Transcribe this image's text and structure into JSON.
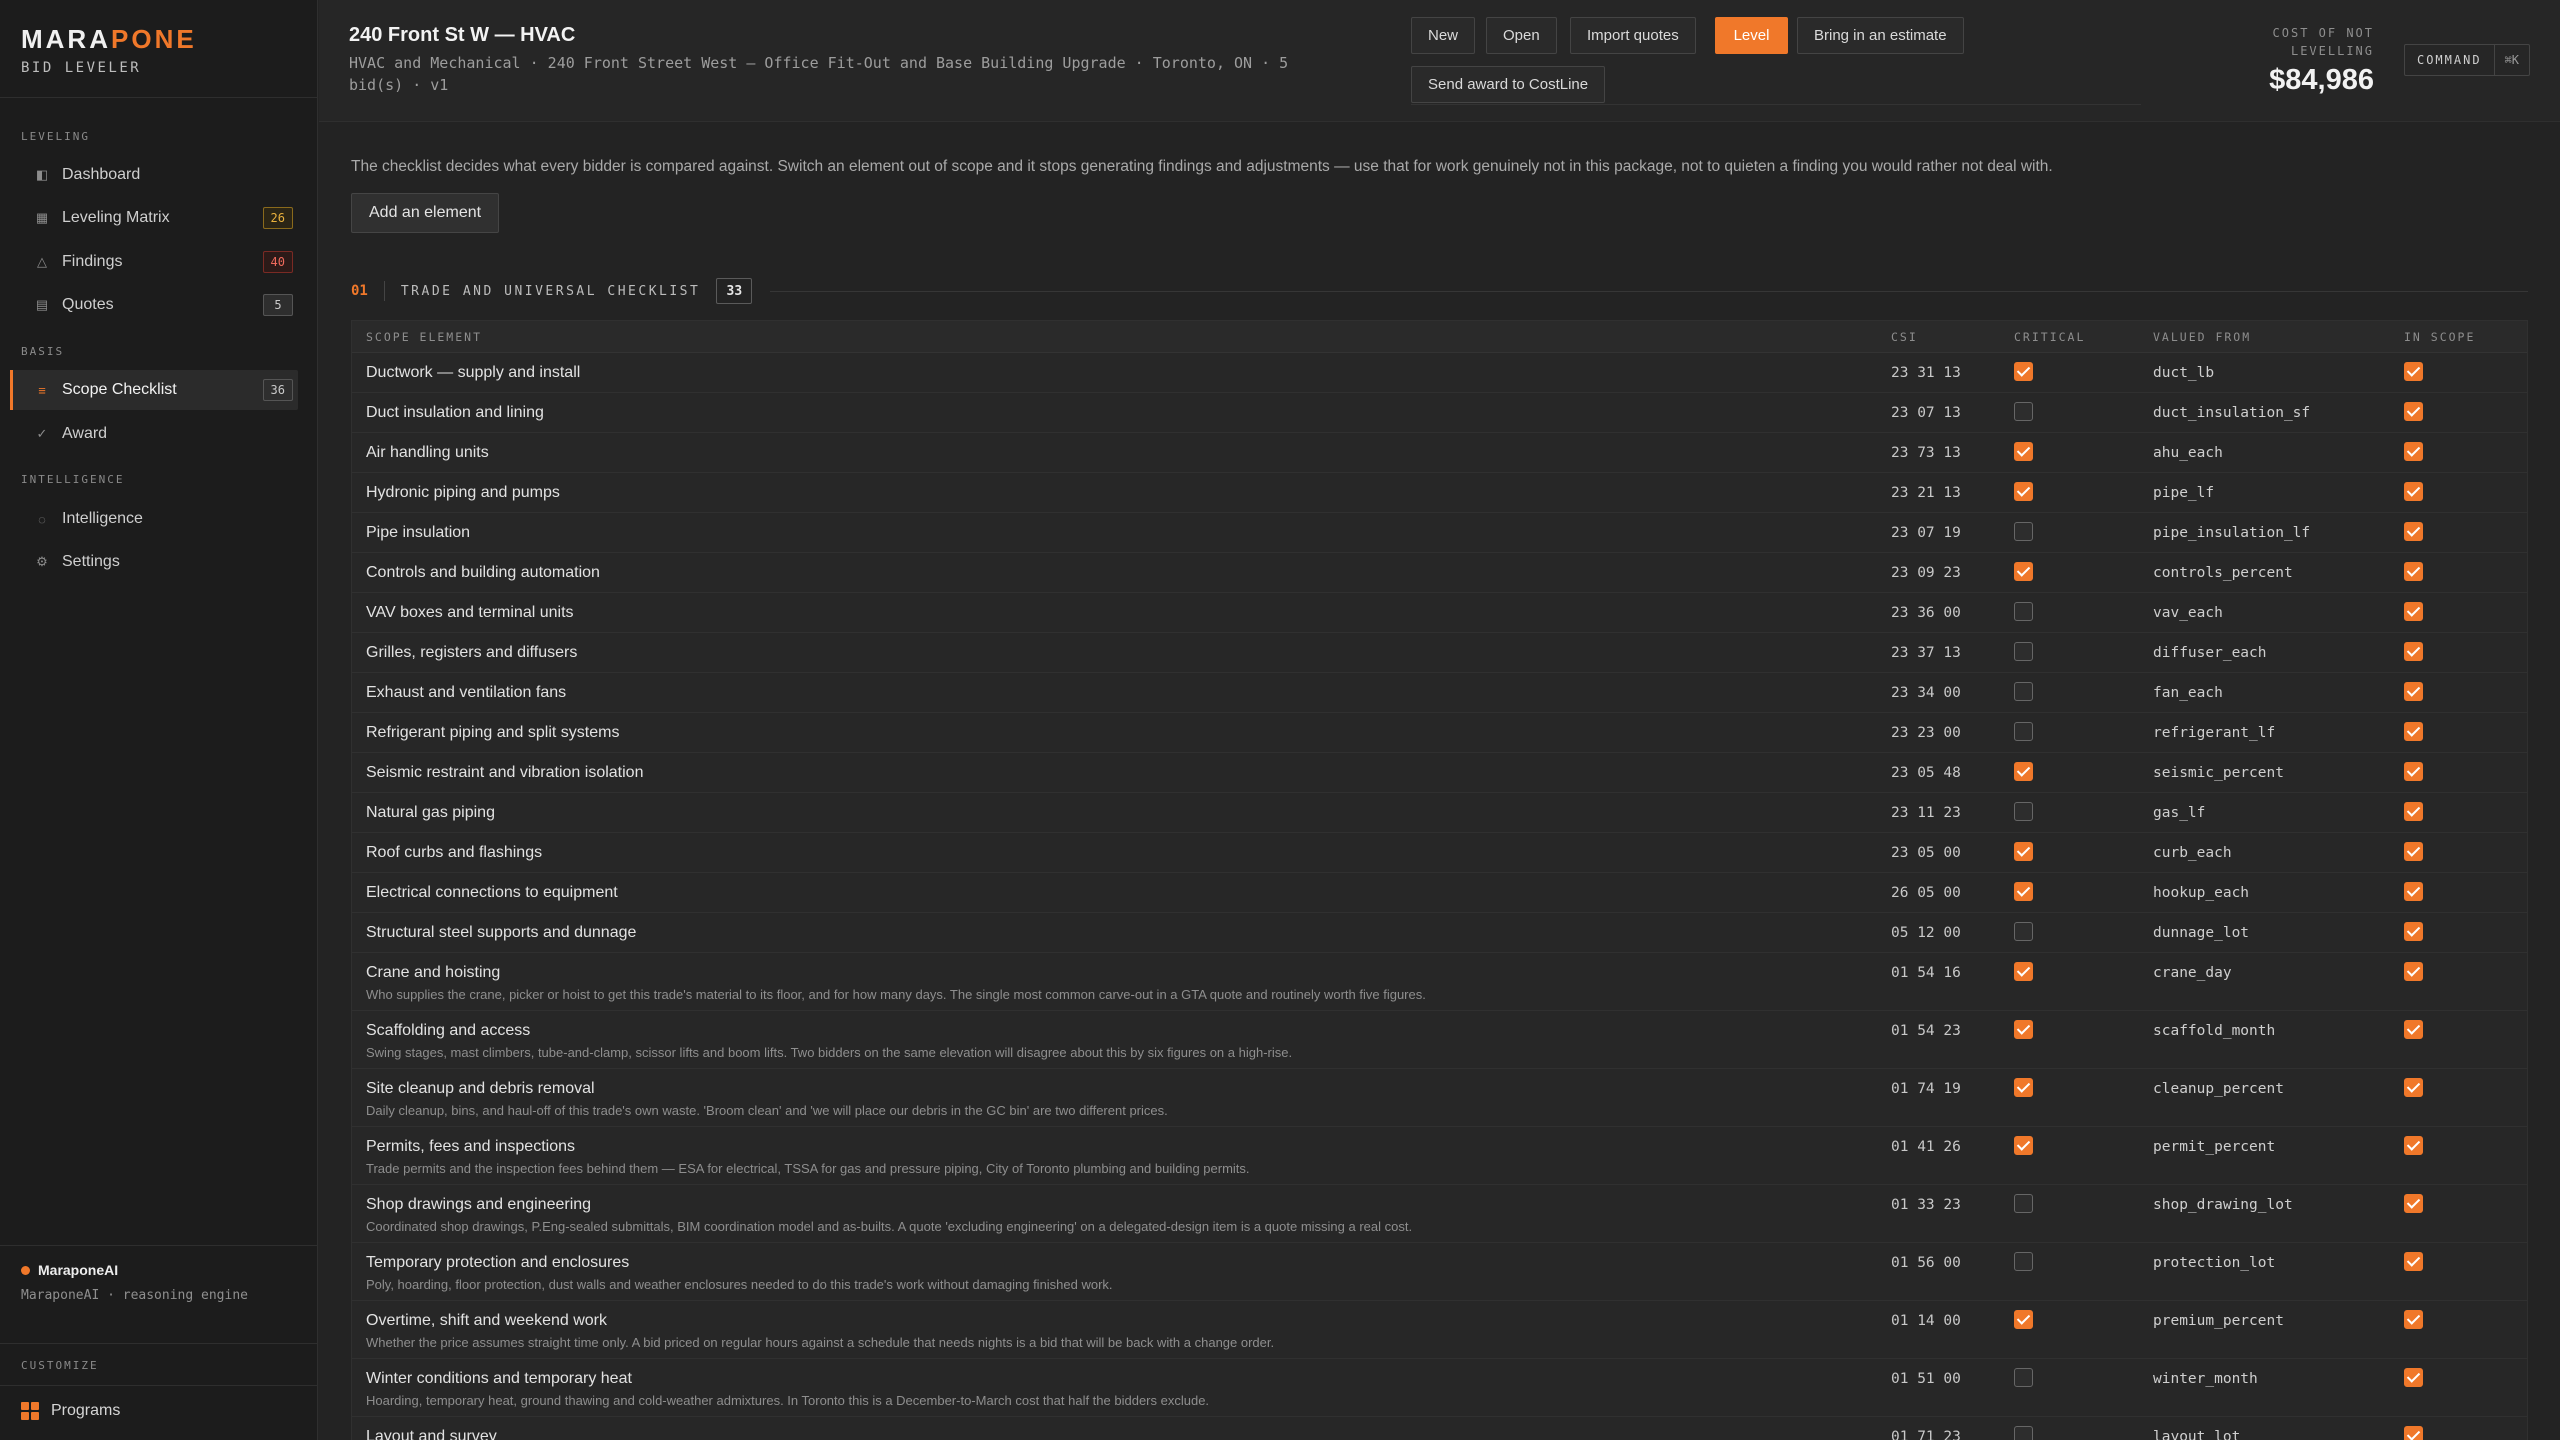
{
  "brand": {
    "name_part1": "MARA",
    "name_part2": "PONE",
    "subtitle": "BID LEVELER"
  },
  "sidebar": {
    "section_leveling": "LEVELING",
    "section_basis": "BASIS",
    "section_intelligence": "INTELLIGENCE",
    "section_customize": "CUSTOMIZE",
    "items": [
      {
        "label": "Dashboard",
        "icon": "square-icon"
      },
      {
        "label": "Leveling Matrix",
        "icon": "grid-icon",
        "badge": "26"
      },
      {
        "label": "Findings",
        "icon": "warning-icon",
        "badge": "40"
      },
      {
        "label": "Quotes",
        "icon": "document-icon",
        "badge": "5"
      },
      {
        "label": "Scope Checklist",
        "icon": "list-icon",
        "badge": "36"
      },
      {
        "label": "Award",
        "icon": "check-icon"
      },
      {
        "label": "Intelligence",
        "icon": "circle-icon"
      },
      {
        "label": "Settings",
        "icon": "gear-icon"
      }
    ],
    "ai_name": "MaraponeAI",
    "ai_sub": "MaraponeAI · reasoning engine",
    "programs_label": "Programs"
  },
  "header": {
    "title": "240 Front St W — HVAC",
    "subtitle": "HVAC and Mechanical · 240 Front Street West — Office Fit-Out and Base Building Upgrade · Toronto, ON · 5 bid(s) · v1",
    "buttons": {
      "new": "New",
      "open": "Open",
      "import": "Import quotes",
      "level": "Level",
      "estimate": "Bring in an estimate",
      "award": "Send award to CostLine"
    },
    "cost_label": "COST OF NOT LEVELLING",
    "cost_value": "$84,986",
    "command_label": "COMMAND",
    "command_key": "⌘K"
  },
  "main": {
    "intro": "The checklist decides what every bidder is compared against. Switch an element out of scope and it stops generating findings and adjustments — use that for work genuinely not in this package, not to quieten a finding you would rather not deal with.",
    "add_button": "Add an element",
    "section_num": "01",
    "section_title": "TRADE AND UNIVERSAL CHECKLIST",
    "section_count": "33",
    "columns": {
      "element": "SCOPE ELEMENT",
      "csi": "CSI",
      "critical": "CRITICAL",
      "valued": "VALUED FROM",
      "scope": "IN SCOPE"
    }
  },
  "rows": [
    {
      "name": "Ductwork — supply and install",
      "csi": "23 31 13",
      "critical": true,
      "valued": "duct_lb",
      "scope": true
    },
    {
      "name": "Duct insulation and lining",
      "csi": "23 07 13",
      "critical": false,
      "valued": "duct_insulation_sf",
      "scope": true
    },
    {
      "name": "Air handling units",
      "csi": "23 73 13",
      "critical": true,
      "valued": "ahu_each",
      "scope": true
    },
    {
      "name": "Hydronic piping and pumps",
      "csi": "23 21 13",
      "critical": true,
      "valued": "pipe_lf",
      "scope": true
    },
    {
      "name": "Pipe insulation",
      "csi": "23 07 19",
      "critical": false,
      "valued": "pipe_insulation_lf",
      "scope": true
    },
    {
      "name": "Controls and building automation",
      "csi": "23 09 23",
      "critical": true,
      "valued": "controls_percent",
      "scope": true
    },
    {
      "name": "VAV boxes and terminal units",
      "csi": "23 36 00",
      "critical": false,
      "valued": "vav_each",
      "scope": true
    },
    {
      "name": "Grilles, registers and diffusers",
      "csi": "23 37 13",
      "critical": false,
      "valued": "diffuser_each",
      "scope": true
    },
    {
      "name": "Exhaust and ventilation fans",
      "csi": "23 34 00",
      "critical": false,
      "valued": "fan_each",
      "scope": true
    },
    {
      "name": "Refrigerant piping and split systems",
      "csi": "23 23 00",
      "critical": false,
      "valued": "refrigerant_lf",
      "scope": true
    },
    {
      "name": "Seismic restraint and vibration isolation",
      "csi": "23 05 48",
      "critical": true,
      "valued": "seismic_percent",
      "scope": true
    },
    {
      "name": "Natural gas piping",
      "csi": "23 11 23",
      "critical": false,
      "valued": "gas_lf",
      "scope": true
    },
    {
      "name": "Roof curbs and flashings",
      "csi": "23 05 00",
      "critical": true,
      "valued": "curb_each",
      "scope": true
    },
    {
      "name": "Electrical connections to equipment",
      "csi": "26 05 00",
      "critical": true,
      "valued": "hookup_each",
      "scope": true
    },
    {
      "name": "Structural steel supports and dunnage",
      "csi": "05 12 00",
      "critical": false,
      "valued": "dunnage_lot",
      "scope": true
    },
    {
      "name": "Crane and hoisting",
      "desc": "Who supplies the crane, picker or hoist to get this trade's material to its floor, and for how many days. The single most common carve-out in a GTA quote and routinely worth five figures.",
      "csi": "01 54 16",
      "critical": true,
      "valued": "crane_day",
      "scope": true
    },
    {
      "name": "Scaffolding and access",
      "desc": "Swing stages, mast climbers, tube-and-clamp, scissor lifts and boom lifts. Two bidders on the same elevation will disagree about this by six figures on a high-rise.",
      "csi": "01 54 23",
      "critical": true,
      "valued": "scaffold_month",
      "scope": true
    },
    {
      "name": "Site cleanup and debris removal",
      "desc": "Daily cleanup, bins, and haul-off of this trade's own waste. 'Broom clean' and 'we will place our debris in the GC bin' are two different prices.",
      "csi": "01 74 19",
      "critical": true,
      "valued": "cleanup_percent",
      "scope": true
    },
    {
      "name": "Permits, fees and inspections",
      "desc": "Trade permits and the inspection fees behind them — ESA for electrical, TSSA for gas and pressure piping, City of Toronto plumbing and building permits.",
      "csi": "01 41 26",
      "critical": true,
      "valued": "permit_percent",
      "scope": true
    },
    {
      "name": "Shop drawings and engineering",
      "desc": "Coordinated shop drawings, P.Eng-sealed submittals, BIM coordination model and as-builts. A quote 'excluding engineering' on a delegated-design item is a quote missing a real cost.",
      "csi": "01 33 23",
      "critical": false,
      "valued": "shop_drawing_lot",
      "scope": true
    },
    {
      "name": "Temporary protection and enclosures",
      "desc": "Poly, hoarding, floor protection, dust walls and weather enclosures needed to do this trade's work without damaging finished work.",
      "csi": "01 56 00",
      "critical": false,
      "valued": "protection_lot",
      "scope": true
    },
    {
      "name": "Overtime, shift and weekend work",
      "desc": "Whether the price assumes straight time only. A bid priced on regular hours against a schedule that needs nights is a bid that will be back with a change order.",
      "csi": "01 14 00",
      "critical": true,
      "valued": "premium_percent",
      "scope": true
    },
    {
      "name": "Winter conditions and temporary heat",
      "desc": "Hoarding, temporary heat, ground thawing and cold-weather admixtures. In Toronto this is a December-to-March cost that half the bidders exclude.",
      "csi": "01 51 00",
      "critical": false,
      "valued": "winter_month",
      "scope": true
    },
    {
      "name": "Layout and survey",
      "csi": "01 71 23",
      "critical": false,
      "valued": "layout_lot",
      "scope": true
    }
  ],
  "colors": {
    "accent": "#f0782a",
    "badge_amber": "#e9b13d",
    "badge_red": "#ef6a5c"
  }
}
